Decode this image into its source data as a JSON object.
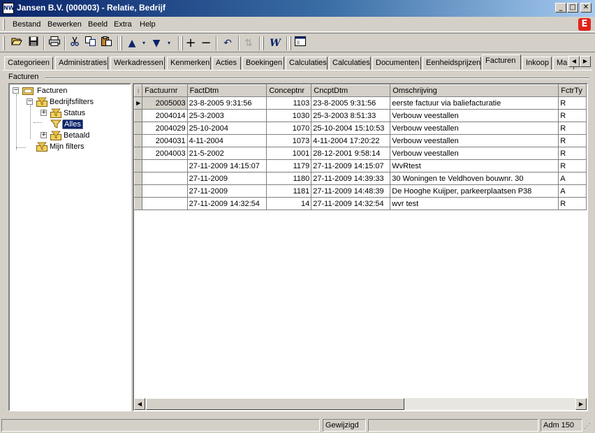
{
  "window": {
    "title": "Jansen B.V. (000003) - Relatie, Bedrijf",
    "min_label": "_",
    "max_label": "□",
    "close_label": "✕"
  },
  "menu": {
    "items": [
      "Bestand",
      "Bewerken",
      "Beeld",
      "Extra",
      "Help"
    ],
    "app_mark": "E"
  },
  "toolbar": {
    "buttons": [
      "open-icon",
      "save-icon",
      "print-icon",
      "cut-icon",
      "copy-icon",
      "paste-icon",
      "arrow-up-icon",
      "dropdown-icon",
      "arrow-down-icon",
      "dropdown-icon",
      "add-icon",
      "remove-icon",
      "undo-icon",
      "refresh-icon",
      "word-icon",
      "window-icon"
    ]
  },
  "tabs": {
    "items": [
      "Categorieen",
      "Administraties",
      "Werkadressen",
      "Kenmerken",
      "Acties",
      "Boekingen",
      "Calculaties",
      "Calculaties",
      "Documenten",
      "Eenheidsprijzen",
      "Facturen",
      "Inkoop",
      "Ma"
    ],
    "active": "Facturen"
  },
  "group": {
    "label": "Facturen"
  },
  "tree": {
    "root": "Facturen",
    "bedrijfsfilters": "Bedrijfsfilters",
    "status": "Status",
    "alles": "Alles",
    "betaald": "Betaald",
    "mijn_filters": "Mijn filters"
  },
  "grid": {
    "columns": [
      "Factuurnr",
      "FactDtm",
      "Conceptnr",
      "CncptDtm",
      "Omschrijving",
      "FctrTy"
    ],
    "rows": [
      [
        "2005003",
        "23-8-2005 9:31:56",
        "1103",
        "23-8-2005 9:31:56",
        "eerste factuur via baliefacturatie",
        "R"
      ],
      [
        "2004014",
        "25-3-2003",
        "1030",
        "25-3-2003 8:51:33",
        "Verbouw veestallen",
        "R"
      ],
      [
        "2004029",
        "25-10-2004",
        "1070",
        "25-10-2004 15:10:53",
        "Verbouw veestallen",
        "R"
      ],
      [
        "2004031",
        "4-11-2004",
        "1073",
        "4-11-2004 17:20:22",
        "Verbouw veestallen",
        "R"
      ],
      [
        "2004003",
        "21-5-2002",
        "1001",
        "28-12-2001 9:58:14",
        "Verbouw veestallen",
        "R"
      ],
      [
        "",
        "27-11-2009 14:15:07",
        "1179",
        "27-11-2009 14:15:07",
        "WvRtest",
        "R"
      ],
      [
        "",
        "27-11-2009",
        "1180",
        "27-11-2009 14:39:33",
        "30 Woningen te Veldhoven bouwnr. 30",
        "A"
      ],
      [
        "",
        "27-11-2009",
        "1181",
        "27-11-2009 14:48:39",
        "De Hooghe Kuijper, parkeerplaatsen P38",
        "A"
      ],
      [
        "",
        "27-11-2009 14:32:54",
        "14",
        "27-11-2009 14:32:54",
        "wvr test",
        "R"
      ]
    ]
  },
  "status": {
    "state": "Gewijzigd",
    "admin": "Adm 150"
  }
}
